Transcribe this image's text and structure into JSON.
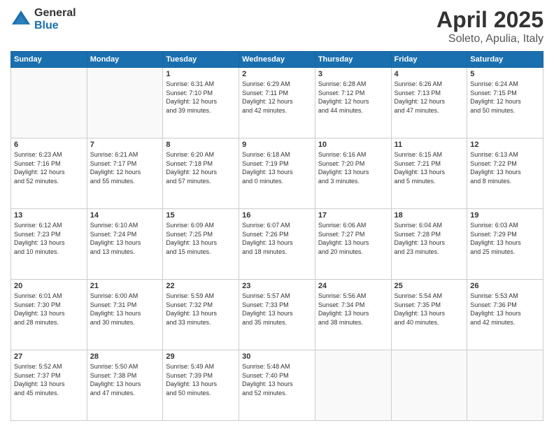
{
  "header": {
    "logo": {
      "general": "General",
      "blue": "Blue"
    },
    "title": "April 2025",
    "location": "Soleto, Apulia, Italy"
  },
  "weekdays": [
    "Sunday",
    "Monday",
    "Tuesday",
    "Wednesday",
    "Thursday",
    "Friday",
    "Saturday"
  ],
  "weeks": [
    [
      {
        "day": "",
        "info": ""
      },
      {
        "day": "",
        "info": ""
      },
      {
        "day": "1",
        "info": "Sunrise: 6:31 AM\nSunset: 7:10 PM\nDaylight: 12 hours\nand 39 minutes."
      },
      {
        "day": "2",
        "info": "Sunrise: 6:29 AM\nSunset: 7:11 PM\nDaylight: 12 hours\nand 42 minutes."
      },
      {
        "day": "3",
        "info": "Sunrise: 6:28 AM\nSunset: 7:12 PM\nDaylight: 12 hours\nand 44 minutes."
      },
      {
        "day": "4",
        "info": "Sunrise: 6:26 AM\nSunset: 7:13 PM\nDaylight: 12 hours\nand 47 minutes."
      },
      {
        "day": "5",
        "info": "Sunrise: 6:24 AM\nSunset: 7:15 PM\nDaylight: 12 hours\nand 50 minutes."
      }
    ],
    [
      {
        "day": "6",
        "info": "Sunrise: 6:23 AM\nSunset: 7:16 PM\nDaylight: 12 hours\nand 52 minutes."
      },
      {
        "day": "7",
        "info": "Sunrise: 6:21 AM\nSunset: 7:17 PM\nDaylight: 12 hours\nand 55 minutes."
      },
      {
        "day": "8",
        "info": "Sunrise: 6:20 AM\nSunset: 7:18 PM\nDaylight: 12 hours\nand 57 minutes."
      },
      {
        "day": "9",
        "info": "Sunrise: 6:18 AM\nSunset: 7:19 PM\nDaylight: 13 hours\nand 0 minutes."
      },
      {
        "day": "10",
        "info": "Sunrise: 6:16 AM\nSunset: 7:20 PM\nDaylight: 13 hours\nand 3 minutes."
      },
      {
        "day": "11",
        "info": "Sunrise: 6:15 AM\nSunset: 7:21 PM\nDaylight: 13 hours\nand 5 minutes."
      },
      {
        "day": "12",
        "info": "Sunrise: 6:13 AM\nSunset: 7:22 PM\nDaylight: 13 hours\nand 8 minutes."
      }
    ],
    [
      {
        "day": "13",
        "info": "Sunrise: 6:12 AM\nSunset: 7:23 PM\nDaylight: 13 hours\nand 10 minutes."
      },
      {
        "day": "14",
        "info": "Sunrise: 6:10 AM\nSunset: 7:24 PM\nDaylight: 13 hours\nand 13 minutes."
      },
      {
        "day": "15",
        "info": "Sunrise: 6:09 AM\nSunset: 7:25 PM\nDaylight: 13 hours\nand 15 minutes."
      },
      {
        "day": "16",
        "info": "Sunrise: 6:07 AM\nSunset: 7:26 PM\nDaylight: 13 hours\nand 18 minutes."
      },
      {
        "day": "17",
        "info": "Sunrise: 6:06 AM\nSunset: 7:27 PM\nDaylight: 13 hours\nand 20 minutes."
      },
      {
        "day": "18",
        "info": "Sunrise: 6:04 AM\nSunset: 7:28 PM\nDaylight: 13 hours\nand 23 minutes."
      },
      {
        "day": "19",
        "info": "Sunrise: 6:03 AM\nSunset: 7:29 PM\nDaylight: 13 hours\nand 25 minutes."
      }
    ],
    [
      {
        "day": "20",
        "info": "Sunrise: 6:01 AM\nSunset: 7:30 PM\nDaylight: 13 hours\nand 28 minutes."
      },
      {
        "day": "21",
        "info": "Sunrise: 6:00 AM\nSunset: 7:31 PM\nDaylight: 13 hours\nand 30 minutes."
      },
      {
        "day": "22",
        "info": "Sunrise: 5:59 AM\nSunset: 7:32 PM\nDaylight: 13 hours\nand 33 minutes."
      },
      {
        "day": "23",
        "info": "Sunrise: 5:57 AM\nSunset: 7:33 PM\nDaylight: 13 hours\nand 35 minutes."
      },
      {
        "day": "24",
        "info": "Sunrise: 5:56 AM\nSunset: 7:34 PM\nDaylight: 13 hours\nand 38 minutes."
      },
      {
        "day": "25",
        "info": "Sunrise: 5:54 AM\nSunset: 7:35 PM\nDaylight: 13 hours\nand 40 minutes."
      },
      {
        "day": "26",
        "info": "Sunrise: 5:53 AM\nSunset: 7:36 PM\nDaylight: 13 hours\nand 42 minutes."
      }
    ],
    [
      {
        "day": "27",
        "info": "Sunrise: 5:52 AM\nSunset: 7:37 PM\nDaylight: 13 hours\nand 45 minutes."
      },
      {
        "day": "28",
        "info": "Sunrise: 5:50 AM\nSunset: 7:38 PM\nDaylight: 13 hours\nand 47 minutes."
      },
      {
        "day": "29",
        "info": "Sunrise: 5:49 AM\nSunset: 7:39 PM\nDaylight: 13 hours\nand 50 minutes."
      },
      {
        "day": "30",
        "info": "Sunrise: 5:48 AM\nSunset: 7:40 PM\nDaylight: 13 hours\nand 52 minutes."
      },
      {
        "day": "",
        "info": ""
      },
      {
        "day": "",
        "info": ""
      },
      {
        "day": "",
        "info": ""
      }
    ]
  ]
}
